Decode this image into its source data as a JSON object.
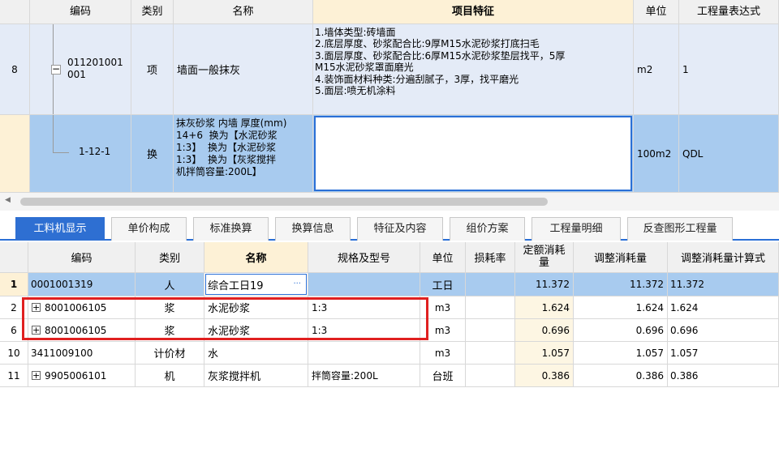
{
  "top_table": {
    "headers": {
      "code": "编码",
      "type": "类别",
      "name": "名称",
      "features": "项目特征",
      "unit": "单位",
      "expr": "工程量表达式"
    },
    "row1": {
      "num": "8",
      "code": "011201001\n001",
      "type": "项",
      "name": "墙面一般抹灰",
      "features": "1.墙体类型:砖墙面\n2.底层厚度、砂浆配合比:9厚M15水泥砂浆打底扫毛\n3.面层厚度、砂浆配合比:6厚M15水泥砂浆垫层找平，5厚\nM15水泥砂浆罩面磨光\n4.装饰面材料种类:分遍刮腻子，3厚，找平磨光\n5.面层:喷无机涂料",
      "unit": "m2",
      "expr": "1",
      "collapse_symbol": "−"
    },
    "row2": {
      "code": "1-12-1",
      "type": "换",
      "name": "抹灰砂浆 内墙 厚度(mm)\n14+6  换为【水泥砂浆\n1:3】  换为【水泥砂浆\n1:3】  换为【灰浆搅拌\n机拌筒容量:200L】",
      "features": "",
      "unit": "100m2",
      "expr": "QDL"
    }
  },
  "tabs": [
    "工料机显示",
    "单价构成",
    "标准换算",
    "换算信息",
    "特征及内容",
    "组价方案",
    "工程量明细",
    "反查图形工程量"
  ],
  "active_tab": 0,
  "bottom_table": {
    "headers": {
      "code": "编码",
      "type": "类别",
      "name": "名称",
      "spec": "规格及型号",
      "unit": "单位",
      "loss": "损耗率",
      "quota": "定额消耗\n量",
      "adj": "调整消耗量",
      "formula": "调整消耗量计算式"
    },
    "rows": [
      {
        "num": "1",
        "code": "0001001319",
        "type": "人",
        "name": "综合工日19",
        "spec": "",
        "unit": "工日",
        "loss": "",
        "quota": "11.372",
        "adj": "11.372",
        "formula": "11.372",
        "expand": false,
        "ellipsis": "···"
      },
      {
        "num": "2",
        "code": "8001006105",
        "type": "浆",
        "name": "水泥砂浆",
        "spec": "1:3",
        "unit": "m3",
        "loss": "",
        "quota": "1.624",
        "adj": "1.624",
        "formula": "1.624",
        "expand": true
      },
      {
        "num": "6",
        "code": "8001006105",
        "type": "浆",
        "name": "水泥砂浆",
        "spec": "1:3",
        "unit": "m3",
        "loss": "",
        "quota": "0.696",
        "adj": "0.696",
        "formula": "0.696",
        "expand": true
      },
      {
        "num": "10",
        "code": "3411009100",
        "type": "计价材",
        "name": "水",
        "spec": "",
        "unit": "m3",
        "loss": "",
        "quota": "1.057",
        "adj": "1.057",
        "formula": "1.057",
        "expand": false
      },
      {
        "num": "11",
        "code": "9905006101",
        "type": "机",
        "name": "灰浆搅拌机",
        "spec": "拌筒容量:200L",
        "unit": "台班",
        "loss": "",
        "quota": "0.386",
        "adj": "0.386",
        "formula": "0.386",
        "expand": true
      }
    ],
    "expand_symbol": "+"
  },
  "scrollbar": {
    "left_arrow": "◀"
  },
  "colors": {
    "selected_row": "#a8cbef",
    "header_highlight": "#fdf1d6",
    "tab_active": "#2e6fd2",
    "annotation_red": "#e02020"
  }
}
